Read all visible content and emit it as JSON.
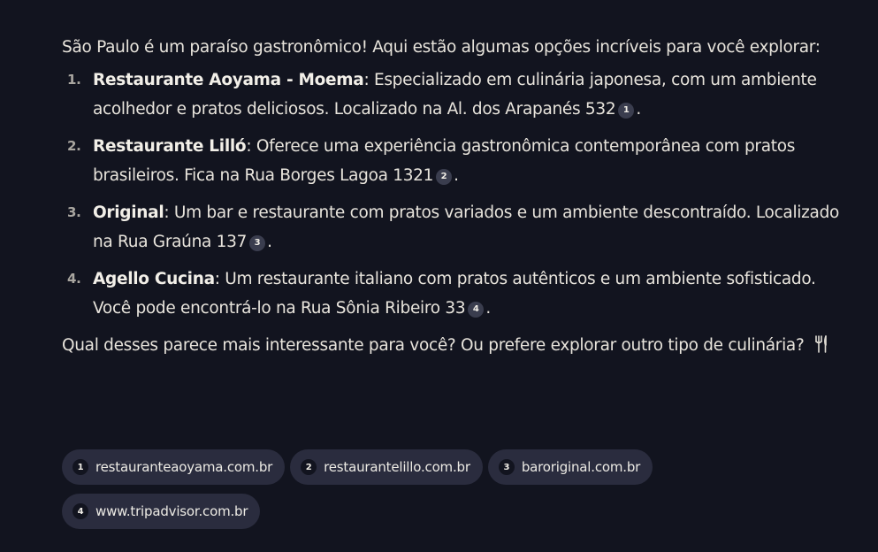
{
  "message": {
    "intro": "São Paulo é um paraíso gastronômico! Aqui estão algumas opções incríveis para você explorar:",
    "items": [
      {
        "number": "1.",
        "name": "Restaurante Aoyama - Moema",
        "text": ": Especializado em culinária japonesa, com um ambiente acolhedor e pratos deliciosos. Localizado na Al. dos Arapanés 532",
        "citation": "1",
        "end": "."
      },
      {
        "number": "2.",
        "name": "Restaurante Lilló",
        "text": ": Oferece uma experiência gastronômica contemporânea com pratos brasileiros. Fica na Rua Borges Lagoa 1321",
        "citation": "2",
        "end": "."
      },
      {
        "number": "3.",
        "name": "Original",
        "text": ": Um bar e restaurante com pratos variados e um ambiente descontraído. Localizado na Rua Graúna 137",
        "citation": "3",
        "end": "."
      },
      {
        "number": "4.",
        "name": "Agello Cucina",
        "text": ": Um restaurante italiano com pratos autênticos e um ambiente sofisticado. Você pode encontrá-lo na Rua Sônia Ribeiro 33",
        "citation": "4",
        "end": "."
      }
    ],
    "outro": "Qual desses parece mais interessante para você? Ou prefere explorar outro tipo de culinária?",
    "outro_icon": "fork-knife-icon"
  },
  "sources": [
    {
      "number": "1",
      "label": "restauranteaoyama.com.br"
    },
    {
      "number": "2",
      "label": "restaurantelillo.com.br"
    },
    {
      "number": "3",
      "label": "baroriginal.com.br"
    },
    {
      "number": "4",
      "label": "www.tripadvisor.com.br"
    }
  ],
  "colors": {
    "background": "#12141f",
    "text": "#e8e4dc",
    "chip_background": "#2a2c3e",
    "citation_badge": "#3a3d4e"
  }
}
